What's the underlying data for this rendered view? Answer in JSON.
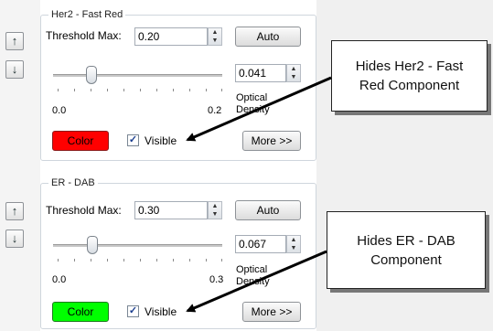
{
  "panels": [
    {
      "title": "Her2 - Fast Red",
      "threshold_label": "Threshold Max:",
      "threshold_value": "0.20",
      "auto_label": "Auto",
      "od_value": "0.041",
      "min_label": "0.0",
      "max_label": "0.2",
      "od_label_line1": "Optical",
      "od_label_line2": "Density",
      "color_label": "Color",
      "color_hex": "#ff0000",
      "visible_label": "Visible",
      "visible_checked": "✓",
      "more_label": "More >>",
      "slider_fraction": 0.21
    },
    {
      "title": "ER - DAB",
      "threshold_label": "Threshold Max:",
      "threshold_value": "0.30",
      "auto_label": "Auto",
      "od_value": "0.067",
      "min_label": "0.0",
      "max_label": "0.3",
      "od_label_line1": "Optical",
      "od_label_line2": "Density",
      "color_label": "Color",
      "color_hex": "#00ff00",
      "visible_label": "Visible",
      "visible_checked": "✓",
      "more_label": "More >>",
      "slider_fraction": 0.22
    }
  ],
  "nav": {
    "up_icon": "arrow-up-icon",
    "down_icon": "arrow-down-icon"
  },
  "callouts": [
    {
      "line1": "Hides Her2 - Fast",
      "line2": "Red Component"
    },
    {
      "line1": "Hides ER - DAB",
      "line2": "Component"
    }
  ]
}
